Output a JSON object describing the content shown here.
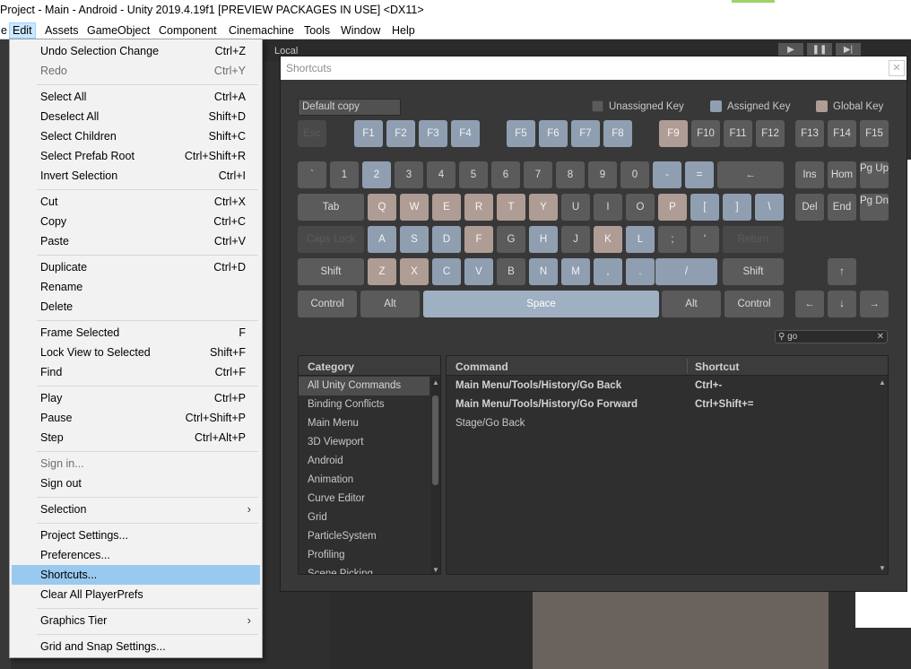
{
  "window": {
    "title": "Project - Main - Android - Unity 2019.4.19f1 [PREVIEW PACKAGES IN USE] <DX11>"
  },
  "menubar": {
    "items": [
      {
        "label": "e"
      },
      {
        "label": "Edit"
      },
      {
        "label": "Assets"
      },
      {
        "label": "GameObject"
      },
      {
        "label": "Component"
      },
      {
        "label": "Cinemachine"
      },
      {
        "label": "Tools"
      },
      {
        "label": "Window"
      },
      {
        "label": "Help"
      }
    ]
  },
  "editor": {
    "local_label": "Local"
  },
  "edit_menu": {
    "items": [
      {
        "label": "Undo Selection Change",
        "shortcut": "Ctrl+Z"
      },
      {
        "label": "Redo",
        "shortcut": "Ctrl+Y"
      },
      {
        "label": "Select All",
        "shortcut": "Ctrl+A"
      },
      {
        "label": "Deselect All",
        "shortcut": "Shift+D"
      },
      {
        "label": "Select Children",
        "shortcut": "Shift+C"
      },
      {
        "label": "Select Prefab Root",
        "shortcut": "Ctrl+Shift+R"
      },
      {
        "label": "Invert Selection",
        "shortcut": "Ctrl+I"
      },
      {
        "label": "Cut",
        "shortcut": "Ctrl+X"
      },
      {
        "label": "Copy",
        "shortcut": "Ctrl+C"
      },
      {
        "label": "Paste",
        "shortcut": "Ctrl+V"
      },
      {
        "label": "Duplicate",
        "shortcut": "Ctrl+D"
      },
      {
        "label": "Rename",
        "shortcut": ""
      },
      {
        "label": "Delete",
        "shortcut": ""
      },
      {
        "label": "Frame Selected",
        "shortcut": "F"
      },
      {
        "label": "Lock View to Selected",
        "shortcut": "Shift+F"
      },
      {
        "label": "Find",
        "shortcut": "Ctrl+F"
      },
      {
        "label": "Play",
        "shortcut": "Ctrl+P"
      },
      {
        "label": "Pause",
        "shortcut": "Ctrl+Shift+P"
      },
      {
        "label": "Step",
        "shortcut": "Ctrl+Alt+P"
      },
      {
        "label": "Sign in...",
        "shortcut": ""
      },
      {
        "label": "Sign out",
        "shortcut": ""
      },
      {
        "label": "Selection",
        "shortcut": ""
      },
      {
        "label": "Project Settings...",
        "shortcut": ""
      },
      {
        "label": "Preferences...",
        "shortcut": ""
      },
      {
        "label": "Shortcuts...",
        "shortcut": ""
      },
      {
        "label": "Clear All PlayerPrefs",
        "shortcut": ""
      },
      {
        "label": "Graphics Tier",
        "shortcut": ""
      },
      {
        "label": "Grid and Snap Settings...",
        "shortcut": ""
      }
    ]
  },
  "shortcuts": {
    "title": "Shortcuts",
    "profile": "Default copy",
    "legend": {
      "unassigned": "Unassigned Key",
      "assigned": "Assigned Key",
      "global": "Global Key"
    },
    "colors": {
      "unassigned": "#5b5b5b",
      "assigned": "#8f9fb1",
      "global": "#af9c94"
    },
    "keys": {
      "esc": "Esc",
      "f1": "F1",
      "f2": "F2",
      "f3": "F3",
      "f4": "F4",
      "f5": "F5",
      "f6": "F6",
      "f7": "F7",
      "f8": "F8",
      "f9": "F9",
      "f10": "F10",
      "f11": "F11",
      "f12": "F12",
      "f13": "F13",
      "f14": "F14",
      "f15": "F15",
      "backquote": "`",
      "n1": "1",
      "n2": "2",
      "n3": "3",
      "n4": "4",
      "n5": "5",
      "n6": "6",
      "n7": "7",
      "n8": "8",
      "n9": "9",
      "n0": "0",
      "minus": "-",
      "equals": "=",
      "backspace": "←",
      "ins": "Ins",
      "home": "Hom",
      "pgup": "Pg Up",
      "tab": "Tab",
      "q": "Q",
      "w": "W",
      "e": "E",
      "r": "R",
      "t": "T",
      "y": "Y",
      "u": "U",
      "i": "I",
      "o": "O",
      "p": "P",
      "lbracket": "[",
      "rbracket": "]",
      "backslash": "\\",
      "del": "Del",
      "end": "End",
      "pgdn": "Pg Dn",
      "capslock": "Caps Lock",
      "a": "A",
      "s": "S",
      "d": "D",
      "f": "F",
      "g": "G",
      "h": "H",
      "j": "J",
      "k": "K",
      "l": "L",
      "semicolon": ";",
      "quote": "'",
      "return": "Return",
      "lshift": "Shift",
      "z": "Z",
      "x": "X",
      "c": "C",
      "v": "V",
      "b": "B",
      "n": "N",
      "m": "M",
      "comma": ",",
      "period": ".",
      "slash": "/",
      "rshift": "Shift",
      "up": "↑",
      "lcontrol": "Control",
      "lalt": "Alt",
      "space": "Space",
      "ralt": "Alt",
      "rcontrol": "Control",
      "left": "←",
      "down": "↓",
      "right": "→"
    },
    "search_value": "go",
    "category": {
      "header": "Category",
      "items": [
        "All Unity Commands",
        "Binding Conflicts",
        "Main Menu",
        "3D Viewport",
        "Android",
        "Animation",
        "Curve Editor",
        "Grid",
        "ParticleSystem",
        "Profiling",
        "Scene Picking"
      ]
    },
    "commands": {
      "header_command": "Command",
      "header_shortcut": "Shortcut",
      "rows": [
        {
          "command": "Main Menu/Tools/History/Go Back",
          "shortcut": "Ctrl+-"
        },
        {
          "command": "Main Menu/Tools/History/Go Forward",
          "shortcut": "Ctrl+Shift+="
        },
        {
          "command": "Stage/Go Back",
          "shortcut": ""
        }
      ]
    }
  }
}
